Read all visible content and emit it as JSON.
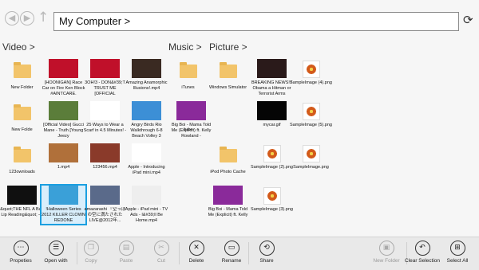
{
  "address": {
    "text": "My Computer >"
  },
  "sections": {
    "video": "Video >",
    "music": "Music >",
    "picture": "Picture >"
  },
  "video": [
    {
      "label": "New Folder",
      "kind": "folder"
    },
    {
      "label": "[HOONIGAN] Race Car on Fire Ken Block #AINTCARE.",
      "kind": "video",
      "color": "#c0102a"
    },
    {
      "label": "3OH!3 - DON&#39;T TRUST ME [OFFICIAL",
      "kind": "video",
      "color": "#c0102a"
    },
    {
      "label": "Amazing Anamorphic Illusions!.mp4",
      "kind": "video",
      "color": "#3a2a22"
    },
    {
      "label": "New Folde",
      "kind": "folder"
    },
    {
      "label": "[Official Video] Gucci Mane - Truth [Young Jeezy",
      "kind": "video",
      "color": "#5b7d3a"
    },
    {
      "label": "25 Ways to Wear a Scarf in 4.5 Minutes! -",
      "kind": "video",
      "color": "#ffffff"
    },
    {
      "label": "Angry Birds Rio Walkthrough 6-8 Beach Volley 3",
      "kind": "video",
      "color": "#3c8fd6"
    },
    {
      "label": "123ownloads",
      "kind": "folder"
    },
    {
      "label": "1.mp4",
      "kind": "video",
      "color": "#b0703a"
    },
    {
      "label": "123456.mp4",
      "kind": "video",
      "color": "#8a3a2a"
    },
    {
      "label": "Apple - Introducing iPad mini.mp4",
      "kind": "video",
      "color": "#ffffff"
    },
    {
      "label": "&quot;THE NFL A Bad Lip Reading&quot; —",
      "kind": "video",
      "color": "#101010"
    },
    {
      "label": "!Halloween Series 2012 KILLER CLOWN REDONE",
      "kind": "video",
      "color": "#3aa0d8"
    },
    {
      "label": "amazarashi 『空っぽの空に満たされた LIVE@2012年...",
      "kind": "video",
      "color": "#5a6a8a"
    },
    {
      "label": "Apple - iPad mini - TV Ads - I&#39;ll Be Home.mp4",
      "kind": "video",
      "color": "#eeeeee"
    }
  ],
  "music": [
    {
      "label": "iTunes",
      "kind": "folder"
    },
    {
      "label": "itube",
      "kind": "folder"
    }
  ],
  "picture": [
    {
      "label": "Windows Simulator",
      "kind": "folder"
    },
    {
      "label": "BREAKING NEWS!!! Obama a Hitman or Terrorist Arms",
      "kind": "video",
      "color": "#2a1a1a"
    },
    {
      "label": "SampleImage (4).png",
      "kind": "image"
    },
    {
      "label": "mycar.gif",
      "kind": "video",
      "color": "#050505"
    },
    {
      "label": "SampleImage (5).png",
      "kind": "image"
    },
    {
      "label": "iPod Photo Cache",
      "kind": "folder"
    },
    {
      "label": "SampleImage (2).png",
      "kind": "image"
    },
    {
      "label": "SampleImage.png",
      "kind": "image"
    },
    {
      "label": "Big Boi - Mama Told Me (Explicit) ft. Kelly",
      "kind": "video",
      "color": "#8a2a9a"
    },
    {
      "label": "SampleImage (3).png",
      "kind": "image"
    }
  ],
  "big_boi": {
    "label": "Big Boi - Mama Told Me (Explicit) ft. Kelly Rowland -",
    "color": "#8a2a9a"
  },
  "toolbar": {
    "properties": "Propeties",
    "open_with": "Open with",
    "copy": "Copy",
    "paste": "Paste",
    "cut": "Cut",
    "delete": "Delete",
    "rename": "Rename",
    "share": "Share",
    "new_folder": "New Folder",
    "clear_selection": "Clear Selection",
    "select_all": "Select All"
  }
}
